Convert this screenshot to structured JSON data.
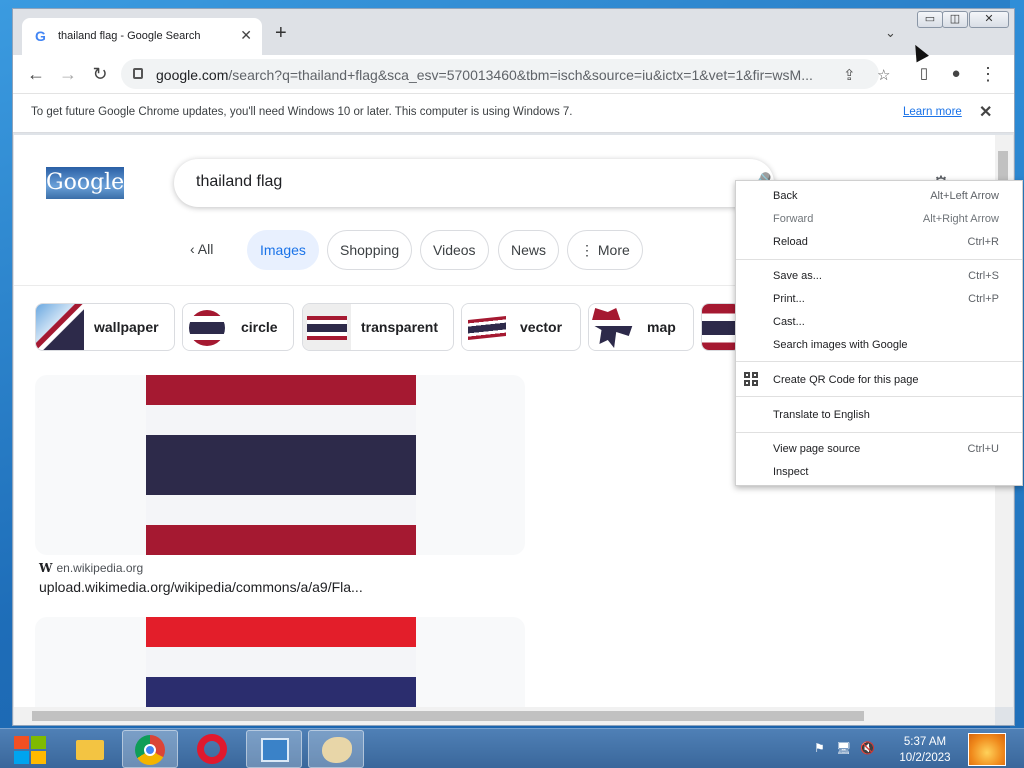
{
  "browser": {
    "tab_title": "thailand flag - Google Search",
    "url_domain": "google.com",
    "url_rest": "/search?q=thailand+flag&sca_esv=570013460&tbm=isch&source=iu&ictx=1&vet=1&fir=wsM...",
    "window_controls": {
      "minimize": "▭",
      "restore": "◫",
      "close": "✕"
    }
  },
  "infobar": {
    "message": "To get future Google Chrome updates, you'll need Windows 10 or later. This computer is using Windows 7.",
    "learn_more": "Learn more"
  },
  "google": {
    "logo_text": "Google",
    "query": "thailand flag",
    "tabs": [
      {
        "label": "All",
        "icon": "chevron-left-icon"
      },
      {
        "label": "Images",
        "active": true
      },
      {
        "label": "Shopping"
      },
      {
        "label": "Videos"
      },
      {
        "label": "News"
      },
      {
        "label": "More",
        "icon": "vertical-dots-icon"
      }
    ],
    "refinements": [
      {
        "label": "wallpaper"
      },
      {
        "label": "circle"
      },
      {
        "label": "transparent"
      },
      {
        "label": "vector"
      },
      {
        "label": "map"
      }
    ],
    "results": [
      {
        "source": "en.wikipedia.org",
        "link": "upload.wikimedia.org/wikipedia/commons/a/a9/Fla..."
      }
    ]
  },
  "context_menu": {
    "items": [
      {
        "label": "Back",
        "shortcut": "Alt+Left Arrow"
      },
      {
        "label": "Forward",
        "shortcut": "Alt+Right Arrow",
        "disabled": true
      },
      {
        "label": "Reload",
        "shortcut": "Ctrl+R"
      },
      {
        "label": "Save as...",
        "shortcut": "Ctrl+S"
      },
      {
        "label": "Print...",
        "shortcut": "Ctrl+P"
      },
      {
        "label": "Cast..."
      },
      {
        "label": "Search images with Google"
      },
      {
        "label": "Create QR Code for this page",
        "icon": "qr-code-icon"
      },
      {
        "label": "Translate to English"
      },
      {
        "label": "View page source",
        "shortcut": "Ctrl+U"
      },
      {
        "label": "Inspect"
      }
    ]
  },
  "taskbar": {
    "time": "5:37 AM",
    "date": "10/2/2023"
  },
  "colors": {
    "flag_red": "#a51931",
    "flag_white": "#f4f5f8",
    "flag_blue": "#2d2a4a",
    "link_blue": "#1a73e8",
    "active_chip": "#e8f0fe"
  }
}
